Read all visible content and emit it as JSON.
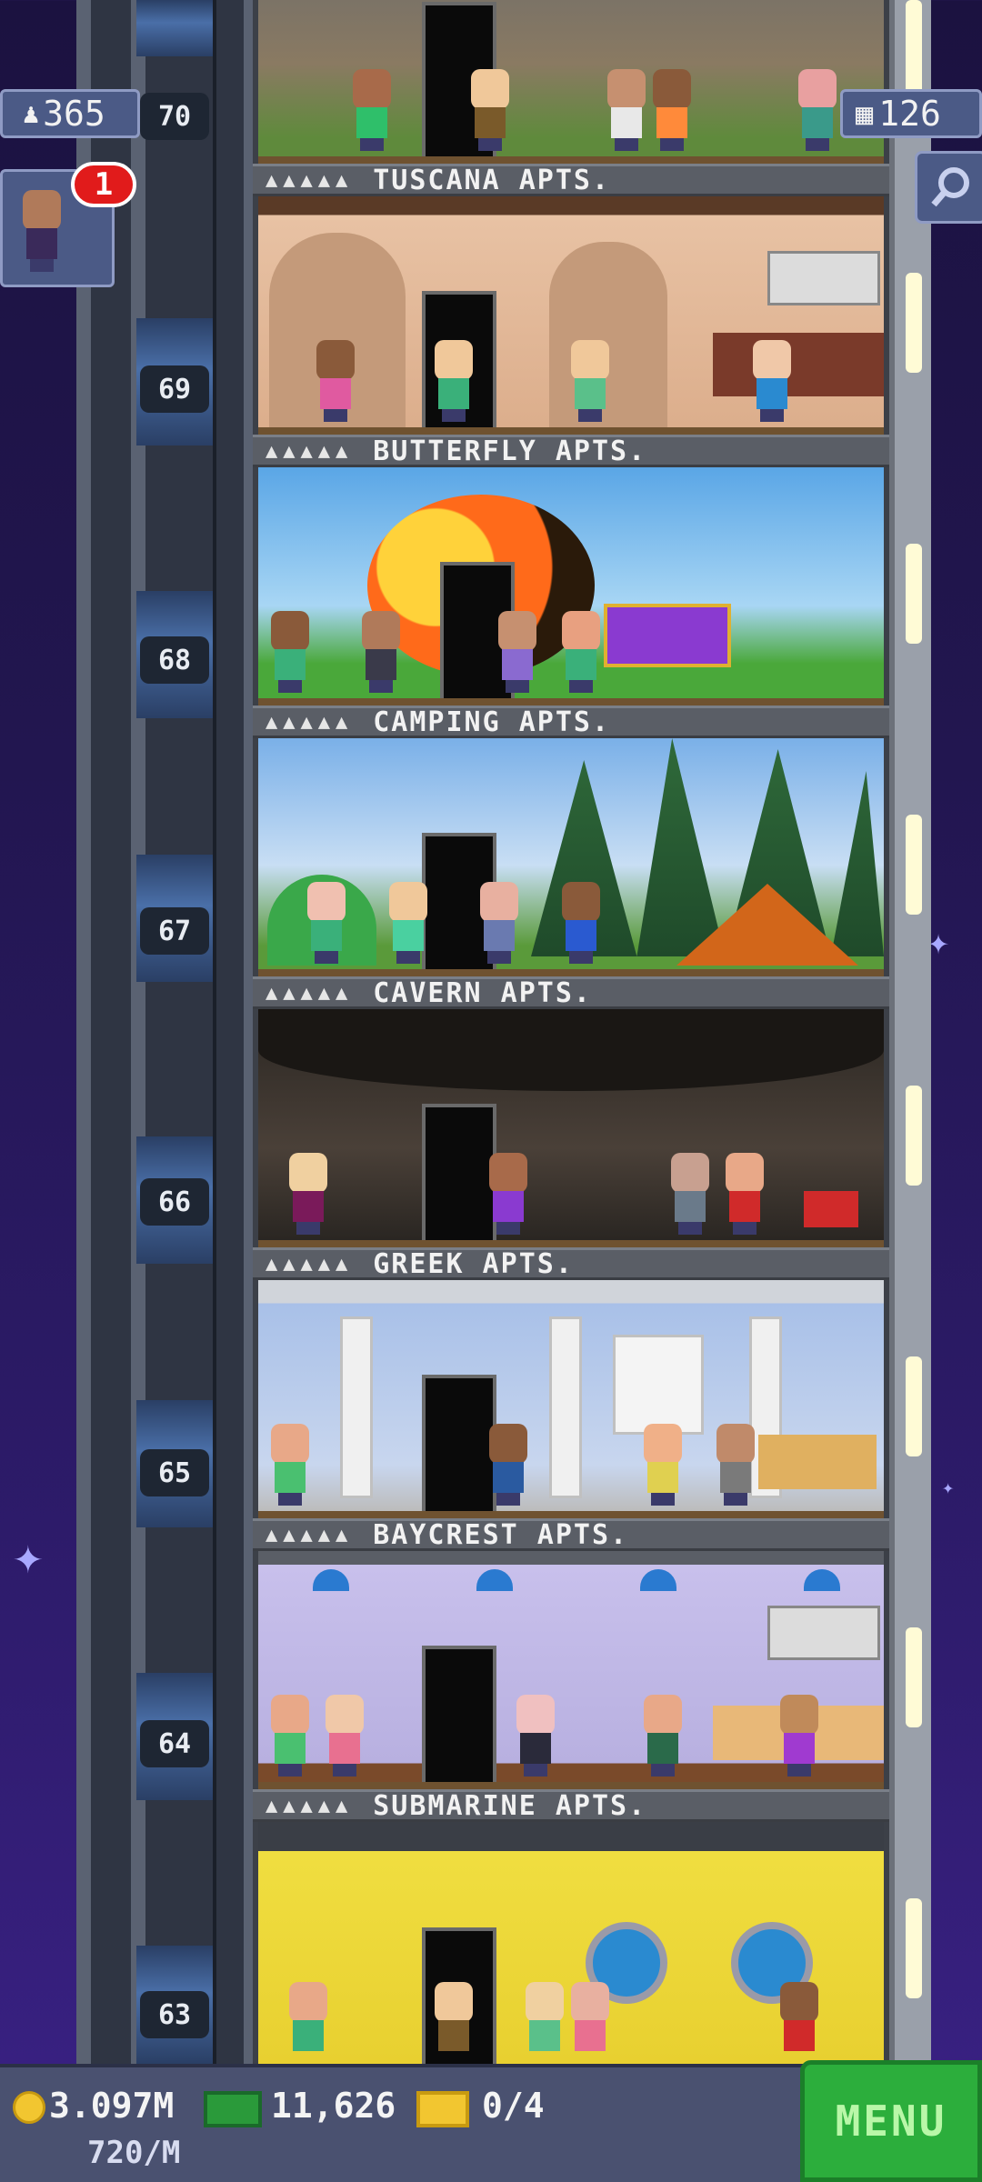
{
  "hud": {
    "population": "365",
    "bux": "126",
    "notification_count": "1",
    "coins": "3.097M",
    "income_rate": "720/M",
    "tower_bux": "11,626",
    "tickets": "0/4",
    "menu_label": "MENU"
  },
  "floors": [
    {
      "number": "70",
      "name": "",
      "theme": "stone"
    },
    {
      "number": "69",
      "name": "TUSCANA APTS.",
      "theme": "tuscana"
    },
    {
      "number": "68",
      "name": "BUTTERFLY APTS.",
      "theme": "butterfly"
    },
    {
      "number": "67",
      "name": "CAMPING APTS.",
      "theme": "camping"
    },
    {
      "number": "66",
      "name": "CAVERN APTS.",
      "theme": "cavern"
    },
    {
      "number": "65",
      "name": "GREEK APTS.",
      "theme": "greek"
    },
    {
      "number": "64",
      "name": "BAYCREST APTS.",
      "theme": "baycrest"
    },
    {
      "number": "63",
      "name": "SUBMARINE APTS.",
      "theme": "submarine"
    }
  ],
  "stars_glyph": "▲▲▲▲▲",
  "colors": {
    "menu_green": "#2cae3c",
    "badge_red": "#e11b1b",
    "hud_blue": "#4b5a86"
  }
}
